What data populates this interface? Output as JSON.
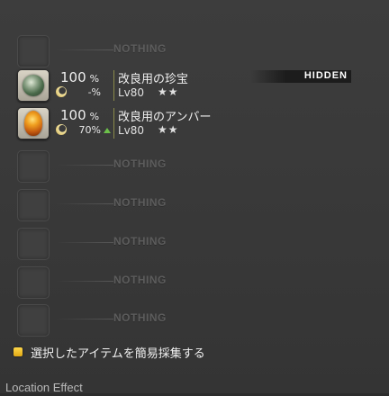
{
  "slots": [
    {
      "type": "empty",
      "label": "NOTHING"
    },
    {
      "type": "item",
      "percent": "100",
      "percent_unit": "%",
      "hq_value": "-%",
      "hq_arrow": false,
      "name": "改良用の珍宝",
      "level": "Lv80",
      "stars": "★★",
      "gem": "green",
      "hidden_label": "HIDDEN"
    },
    {
      "type": "item",
      "percent": "100",
      "percent_unit": "%",
      "hq_value": "70%",
      "hq_arrow": true,
      "name": "改良用のアンバー",
      "level": "Lv80",
      "stars": "★★",
      "gem": "amber"
    },
    {
      "type": "empty",
      "label": "NOTHING"
    },
    {
      "type": "empty",
      "label": "NOTHING"
    },
    {
      "type": "empty",
      "label": "NOTHING"
    },
    {
      "type": "empty",
      "label": "NOTHING"
    },
    {
      "type": "empty",
      "label": "NOTHING"
    }
  ],
  "quick_gather": {
    "label": "選択したアイテムを簡易採集する",
    "checked": true,
    "color": "#f0c030"
  },
  "footer": {
    "label": "Location Effect"
  }
}
